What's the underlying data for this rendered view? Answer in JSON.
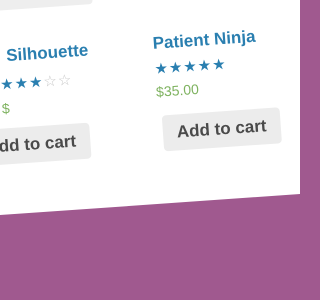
{
  "products": [
    {
      "title": "Silhouette",
      "stars_filled": "★★★",
      "stars_empty": "☆☆",
      "price": "$",
      "button": "Add to cart"
    },
    {
      "title": "Patient Ninja",
      "stars_filled": "★★★★★",
      "stars_empty": "",
      "price": "$35.00",
      "button": "Add to cart"
    }
  ],
  "colors": {
    "link": "#2a7fb0",
    "price": "#7eb25f",
    "background_band": "#a0598f"
  }
}
